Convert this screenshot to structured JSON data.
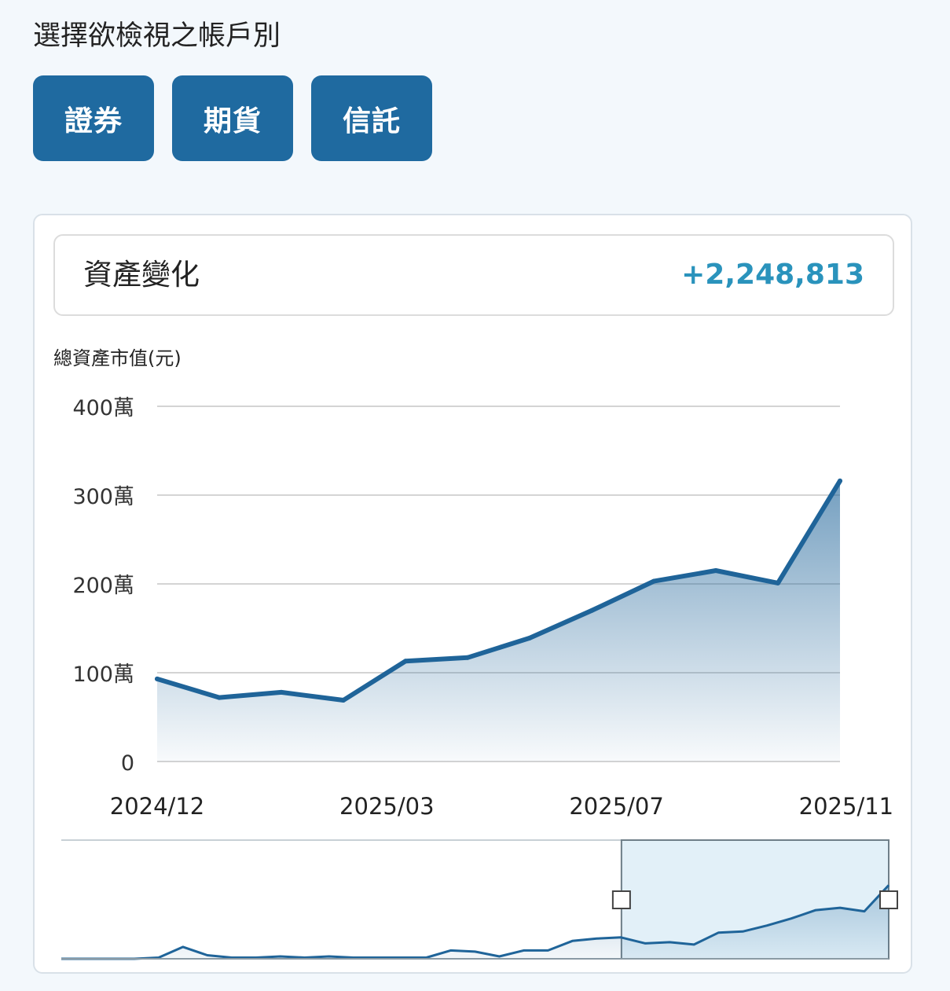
{
  "heading": "選擇欲檢視之帳戶別",
  "accounts": [
    {
      "label": "證券"
    },
    {
      "label": "期貨"
    },
    {
      "label": "信託"
    }
  ],
  "summary": {
    "label": "資產變化",
    "value": "+2,248,813"
  },
  "colors": {
    "accent": "#1f6aa0",
    "value": "#2a93bc",
    "line": "#1f6499"
  },
  "chart_data": {
    "type": "area",
    "ylabel": "總資產市值(元)",
    "ylim": [
      0,
      4000000
    ],
    "yticks": [
      {
        "value": 4000000,
        "label": "400萬"
      },
      {
        "value": 3000000,
        "label": "300萬"
      },
      {
        "value": 2000000,
        "label": "200萬"
      },
      {
        "value": 1000000,
        "label": "100萬"
      },
      {
        "value": 0,
        "label": "0"
      }
    ],
    "xticks": [
      {
        "index": 0,
        "label": "2024/12"
      },
      {
        "index": 3.7,
        "label": "2025/03"
      },
      {
        "index": 7.4,
        "label": "2025/07"
      },
      {
        "index": 11.1,
        "label": "2025/11"
      }
    ],
    "series": [
      {
        "values": [
          930000,
          720000,
          780000,
          690000,
          1130000,
          1170000,
          1390000,
          1700000,
          2030000,
          2150000,
          2010000,
          3160000
        ]
      }
    ],
    "overview": {
      "values": [
        0.0,
        0.0,
        0.0,
        0.0,
        0.01,
        0.1,
        0.03,
        0.01,
        0.01,
        0.02,
        0.01,
        0.02,
        0.01,
        0.01,
        0.01,
        0.01,
        0.07,
        0.06,
        0.02,
        0.07,
        0.07,
        0.15,
        0.17,
        0.18,
        0.13,
        0.14,
        0.12,
        0.22,
        0.23,
        0.28,
        0.34,
        0.41,
        0.43,
        0.4,
        0.62
      ],
      "selection_start": 0.677,
      "selection_end": 1.0
    }
  }
}
